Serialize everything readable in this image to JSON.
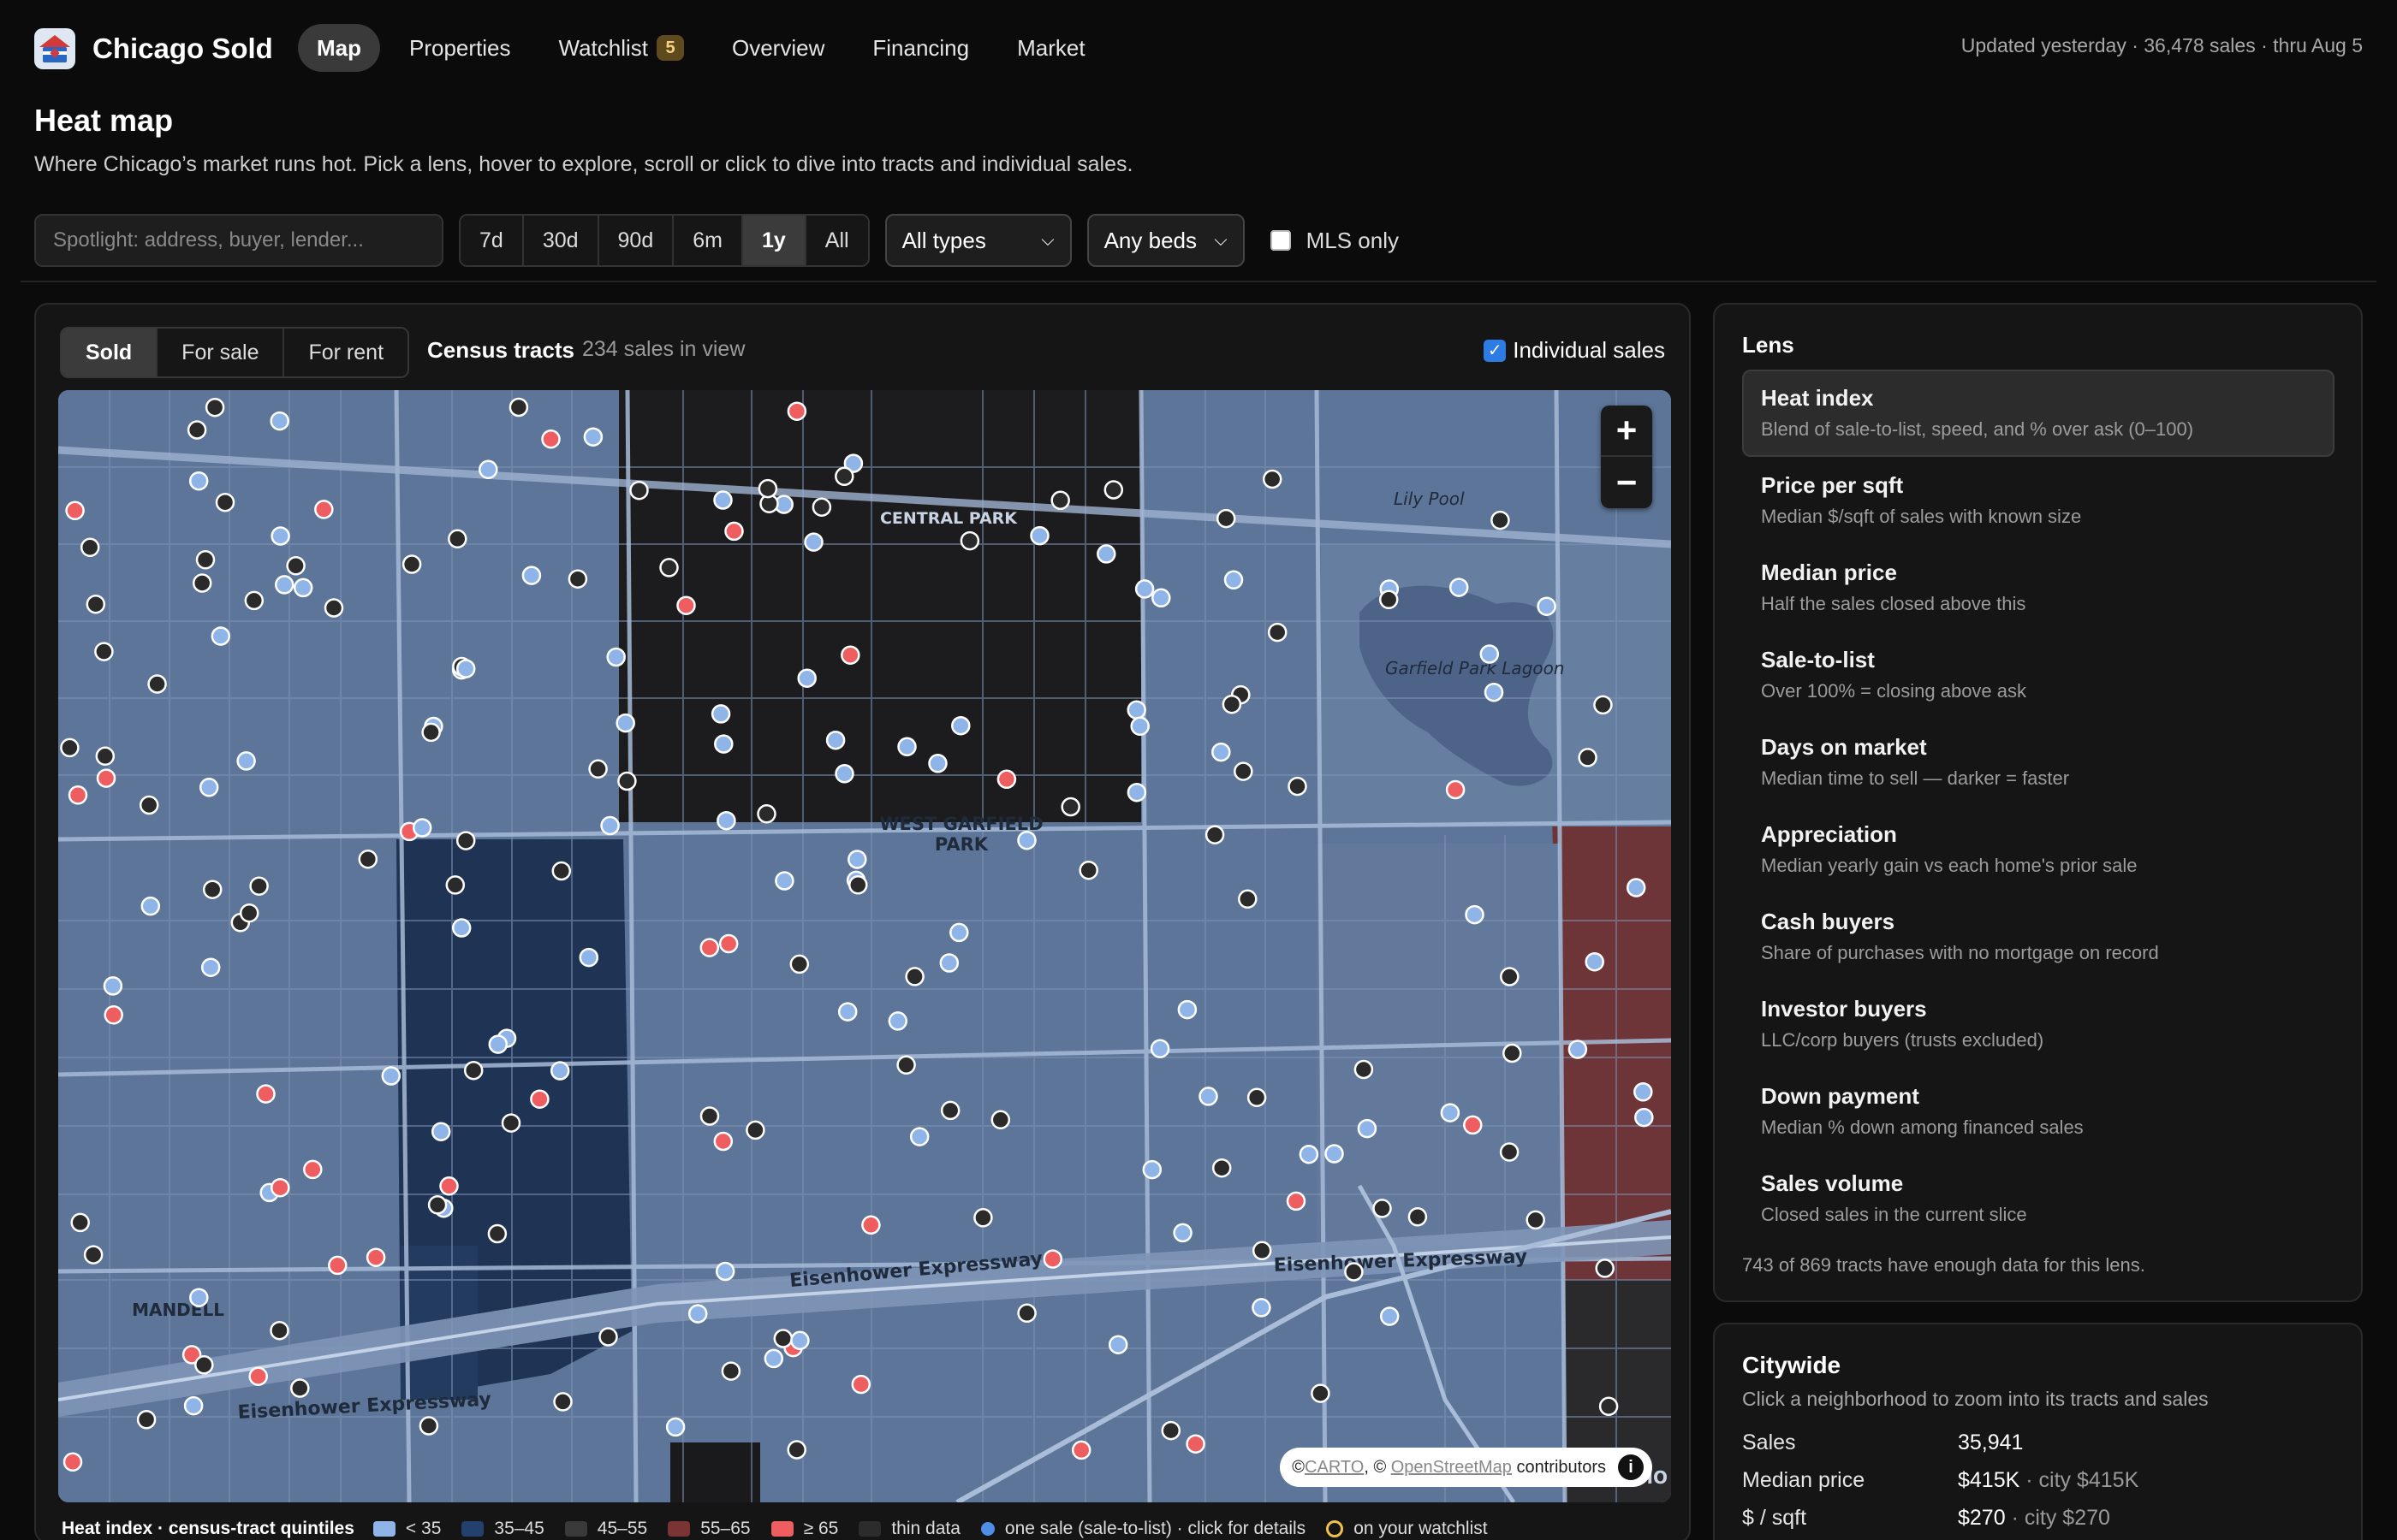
{
  "app": {
    "name": "Chicago Sold",
    "updated": "Updated yesterday · 36,478 sales · thru Aug 5"
  },
  "nav": {
    "items": [
      {
        "label": "Map",
        "active": true
      },
      {
        "label": "Properties"
      },
      {
        "label": "Watchlist",
        "badge": "5"
      },
      {
        "label": "Overview"
      },
      {
        "label": "Financing"
      },
      {
        "label": "Market"
      }
    ]
  },
  "header": {
    "title": "Heat map",
    "subtitle": "Where Chicago’s market runs hot. Pick a lens, hover to explore, scroll or click to dive into tracts and individual sales."
  },
  "filters": {
    "search_placeholder": "Spotlight: address, buyer, lender...",
    "ranges": [
      "7d",
      "30d",
      "90d",
      "6m",
      "1y",
      "All"
    ],
    "active_range": "1y",
    "type_select": "All types",
    "beds_select": "Any beds",
    "mls_label": "MLS only"
  },
  "map": {
    "modes": [
      "Sold",
      "For sale",
      "For rent"
    ],
    "active_mode": "Sold",
    "tract_label": "Census tracts",
    "count": "234 sales in view",
    "individual_label": "Individual sales",
    "place_labels": {
      "central_park": "CENTRAL PARK",
      "west_garfield_1": "WEST GARFIELD",
      "west_garfield_2": "PARK",
      "mandell": "MANDELL",
      "lily_pool": "Lily Pool",
      "lagoon": "Garfield Park Lagoon",
      "ike1": "Eisenhower Expressway",
      "ike2": "Eisenhower Expressway",
      "ike3": "Eisenhower Expressway",
      "ho": "HO"
    },
    "attribution": {
      "prefix": "© ",
      "carto": "CARTO",
      "mid": ", © ",
      "osm": "OpenStreetMap",
      "suffix": " contributors",
      "info": "i"
    },
    "zoom_in": "+",
    "zoom_out": "−",
    "colors": {
      "low": "#8fb4e8",
      "mid_low": "#24416e",
      "mid": "#3a3a3a",
      "mid_high": "#7a3433",
      "high": "#ee5d60",
      "thin": "#2c2c2c",
      "sale": "#4f8ee6",
      "watch": "#f2c04a"
    }
  },
  "legend": {
    "title": "Heat index · census-tract quintiles",
    "items": [
      "< 35",
      "35–45",
      "45–55",
      "55–65",
      "≥ 65",
      "thin data",
      "one sale (sale-to-list) · click for details",
      "on your watchlist"
    ]
  },
  "lens": {
    "heading": "Lens",
    "items": [
      {
        "name": "Heat index",
        "desc": "Blend of sale-to-list, speed, and % over ask (0–100)",
        "active": true
      },
      {
        "name": "Price per sqft",
        "desc": "Median $/sqft of sales with known size"
      },
      {
        "name": "Median price",
        "desc": "Half the sales closed above this"
      },
      {
        "name": "Sale-to-list",
        "desc": "Over 100% = closing above ask"
      },
      {
        "name": "Days on market",
        "desc": "Median time to sell — darker = faster"
      },
      {
        "name": "Appreciation",
        "desc": "Median yearly gain vs each home's prior sale"
      },
      {
        "name": "Cash buyers",
        "desc": "Share of purchases with no mortgage on record"
      },
      {
        "name": "Investor buyers",
        "desc": "LLC/corp buyers (trusts excluded)"
      },
      {
        "name": "Down payment",
        "desc": "Median % down among financed sales"
      },
      {
        "name": "Sales volume",
        "desc": "Closed sales in the current slice"
      }
    ],
    "footnote": "743 of 869 tracts have enough data for this lens."
  },
  "citywide": {
    "title": "Citywide",
    "subtitle": "Click a neighborhood to zoom into its tracts and sales",
    "stats": [
      {
        "label": "Sales",
        "value": "35,941",
        "city": ""
      },
      {
        "label": "Median price",
        "value": "$415K",
        "city": " · city $415K"
      },
      {
        "label": "$ / sqft",
        "value": "$270",
        "city": " · city $270"
      }
    ]
  }
}
